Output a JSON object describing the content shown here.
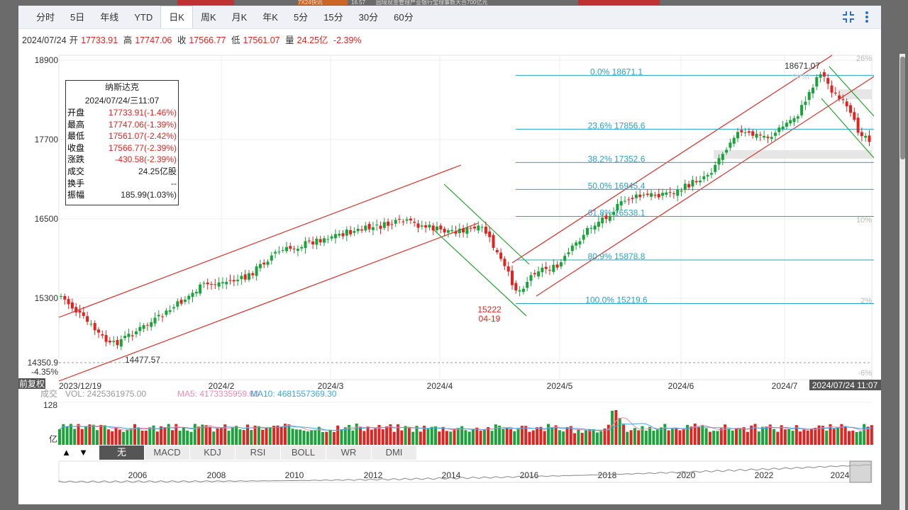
{
  "tabs": [
    {
      "label": "分时"
    },
    {
      "label": "5日"
    },
    {
      "label": "年线"
    },
    {
      "label": "YTD"
    },
    {
      "label": "日K"
    },
    {
      "label": "周K"
    },
    {
      "label": "月K"
    },
    {
      "label": "年K"
    },
    {
      "label": "5分"
    },
    {
      "label": "15分"
    },
    {
      "label": "30分"
    },
    {
      "label": "60分"
    }
  ],
  "active_tab": "日K",
  "banner": {
    "badge": "7X24快讯",
    "ticker": "16.57",
    "news": "园境现金管理产业银行宝理事数大合700亿元"
  },
  "tools": {
    "expand_icon": "compress-arrows-icon",
    "menu_icon": "vertical-dots-icon"
  },
  "info": {
    "date": "2024/07/24",
    "open_label": "开",
    "open": "17733.91",
    "high_label": "高",
    "high": "17747.06",
    "close_label": "收",
    "close": "17566.77",
    "low_label": "低",
    "low": "17561.07",
    "vol_label": "量",
    "vol": "24.25亿",
    "chg": "-2.39%"
  },
  "tooltip": {
    "title": "纳斯达克",
    "date": "2024/07/24/三11:07",
    "rows": [
      {
        "k": "开盘",
        "v": "17733.91(-1.46%)",
        "c": "red"
      },
      {
        "k": "最高",
        "v": "17747.06(-1.39%)",
        "c": "red"
      },
      {
        "k": "最低",
        "v": "17561.07(-2.42%)",
        "c": "red"
      },
      {
        "k": "收盘",
        "v": "17566.77(-2.39%)",
        "c": "red"
      },
      {
        "k": "涨跌",
        "v": "-430.58(-2.39%)",
        "c": "red"
      },
      {
        "k": "成交",
        "v": "24.25亿股",
        "c": "blk"
      },
      {
        "k": "换手",
        "v": "--",
        "c": "blk"
      },
      {
        "k": "振幅",
        "v": "185.99(1.03%)",
        "c": "blk"
      }
    ]
  },
  "y_axis": {
    "labels": [
      "18900",
      "17700",
      "16500",
      "15300"
    ],
    "values": [
      18900,
      17700,
      16500,
      15300
    ],
    "cur_value": "14350.9",
    "cur_pct": "-4.35%"
  },
  "right_pct": [
    "26%",
    "10%",
    "2%",
    "-6%"
  ],
  "x_axis": {
    "labels": [
      "2023/12/19",
      "2024/2",
      "2024/3",
      "2024/4",
      "2024/5",
      "2024/6",
      "2024/7"
    ],
    "cursor_label": "2024/07/24 11:07"
  },
  "fib": [
    {
      "label": "0.0% 18671.1",
      "value": 18671.1
    },
    {
      "label": "23.6% 17856.6",
      "value": 17856.6
    },
    {
      "label": "38.2% 17352.6",
      "value": 17352.6
    },
    {
      "label": "50.0% 16945.4",
      "value": 16945.4
    },
    {
      "label": "61.8% 16538.1",
      "value": 16538.1
    },
    {
      "label": "80.9% 15878.8",
      "value": 15878.8
    },
    {
      "label": "100.0% 15219.6",
      "value": 15219.6
    }
  ],
  "annotations": {
    "low_start": "14477.57",
    "mid_low": "15222",
    "mid_low_date": "04-19",
    "high": "18671.07",
    "watermark": "sina"
  },
  "adjust_label": "前复权",
  "vol_legend": {
    "label": "成交",
    "vol": "VOL: 2425361975.00",
    "ma5": "MA5: 4173335959.60",
    "ma10": "MA10: 4681557369.30",
    "top": "128",
    "unit": "亿"
  },
  "indicators": [
    "无",
    "MACD",
    "KDJ",
    "RSI",
    "BOLL",
    "WR",
    "DMI"
  ],
  "active_indicator": "无",
  "arrows": {
    "up": "▲",
    "down": "▼"
  },
  "overview_years": [
    "2006",
    "2008",
    "2010",
    "2012",
    "2014",
    "2016",
    "2018",
    "2020",
    "2022",
    "2024"
  ],
  "colors": {
    "up": "#e3231f",
    "down": "#1aa33a",
    "fib": "#2aa3c6",
    "channel_red": "#d9312b",
    "channel_green": "#25a32f",
    "ma5": "#f08ab0",
    "ma10": "#3aa8dc"
  },
  "chart_data": {
    "type": "candlestick",
    "title": "纳斯达克",
    "ylim": [
      14350.9,
      18900
    ],
    "key_points": [
      {
        "date": "2023/12/19",
        "value": 14477.57,
        "note": "low"
      },
      {
        "date": "2024/04/19",
        "value": 15222,
        "note": "low"
      },
      {
        "date": "2024/07",
        "value": 18671.07,
        "note": "high"
      },
      {
        "date": "2024/07/24",
        "open": 17733.91,
        "high": 17747.06,
        "low": 17561.07,
        "close": 17566.77
      }
    ]
  }
}
